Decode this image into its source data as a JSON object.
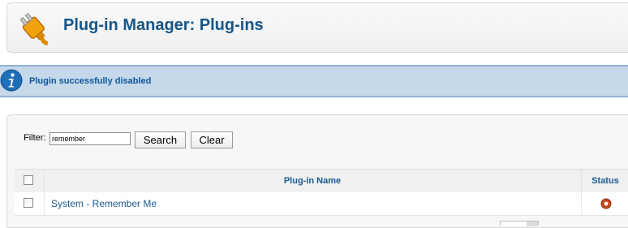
{
  "header": {
    "title": "Plug-in Manager: Plug-ins",
    "logo_icon": "plug-icon"
  },
  "message": {
    "icon": "info-icon",
    "text": "Plugin successfully disabled"
  },
  "filter": {
    "label": "Filter:",
    "value": "remember",
    "search_label": "Search",
    "clear_label": "Clear"
  },
  "table": {
    "columns": {
      "name": "Plug-in Name",
      "status": "Status"
    },
    "rows": [
      {
        "name": "System - Remember Me",
        "status": "disabled"
      }
    ]
  },
  "colors": {
    "title": "#14568a",
    "message_bg": "#c6d9ea",
    "status_disabled": "#c84a1c"
  }
}
